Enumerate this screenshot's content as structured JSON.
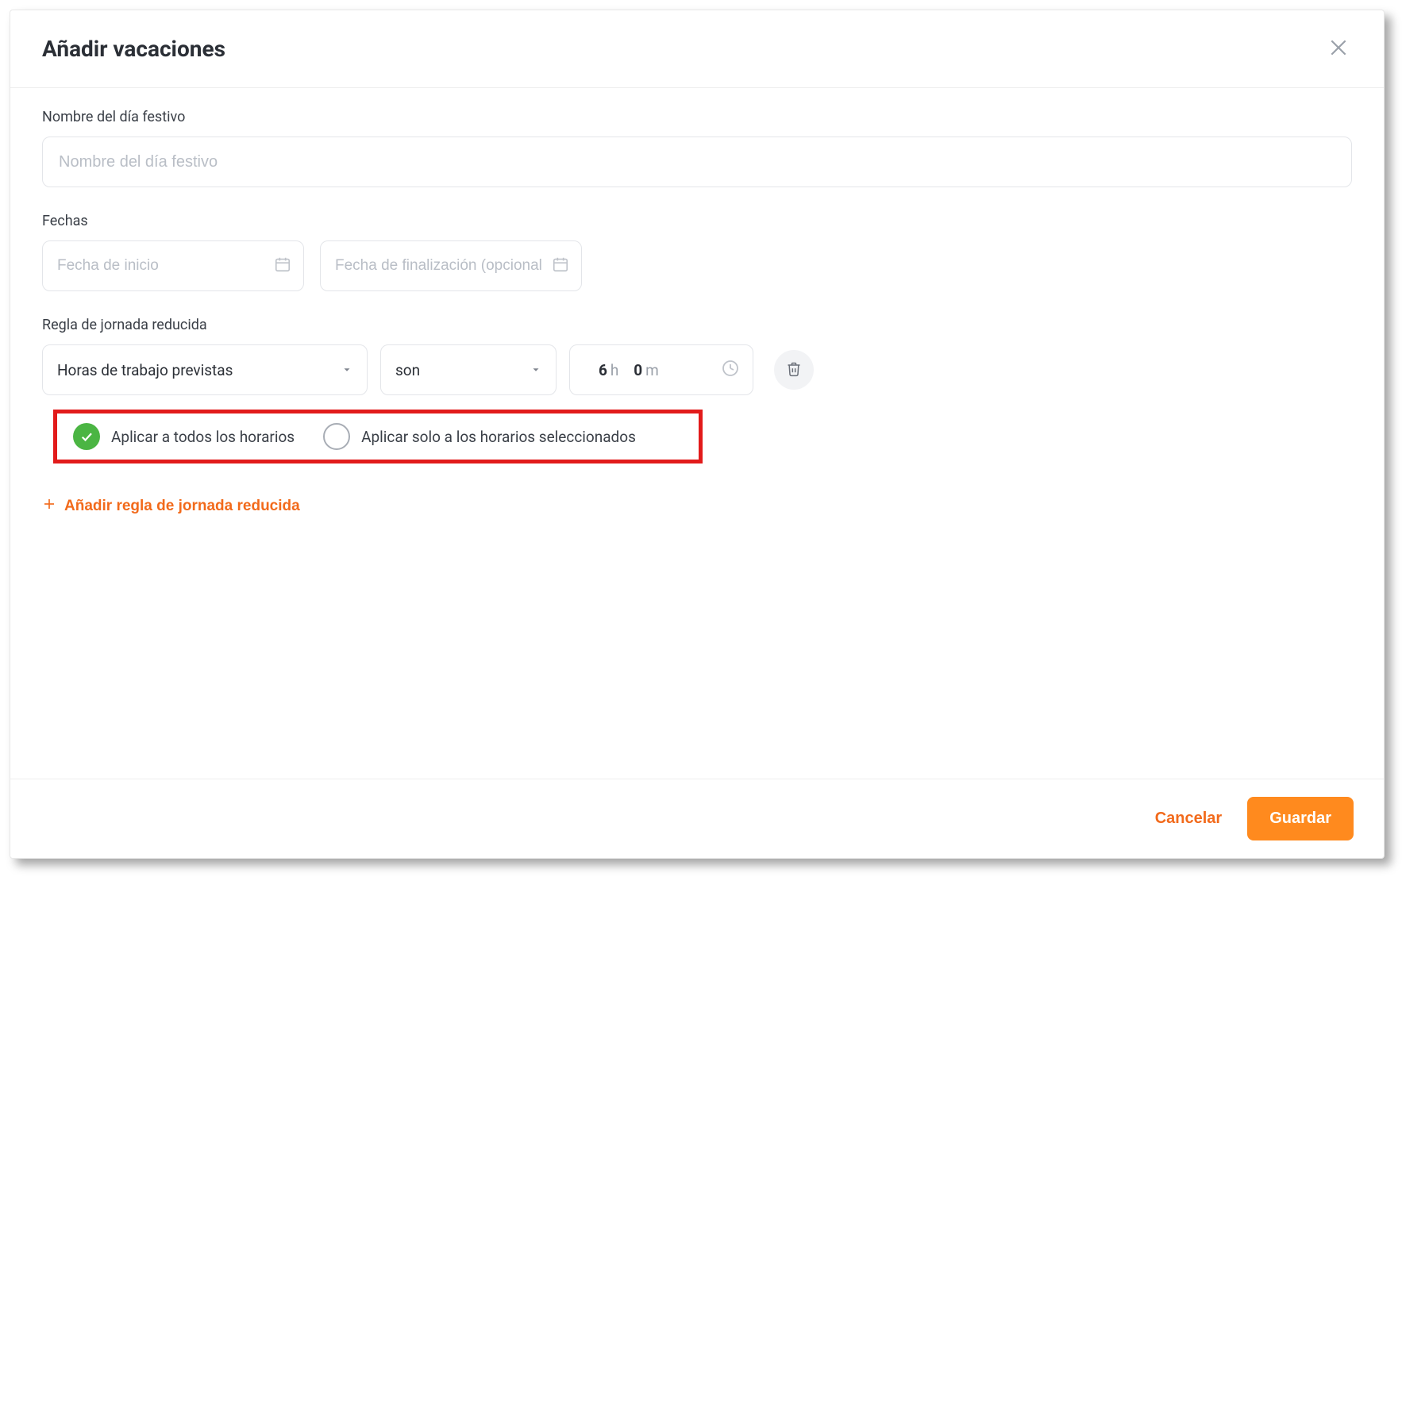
{
  "modal": {
    "title": "Añadir vacaciones"
  },
  "holidayName": {
    "label": "Nombre del día festivo",
    "placeholder": "Nombre del día festivo"
  },
  "dates": {
    "label": "Fechas",
    "startPlaceholder": "Fecha de inicio",
    "endPlaceholder": "Fecha de finalización (opcional)"
  },
  "rule": {
    "label": "Regla de jornada reducida",
    "typeSelected": "Horas de trabajo previstas",
    "operatorSelected": "son",
    "hours": "6",
    "hoursUnit": "h",
    "minutes": "0",
    "minutesUnit": "m"
  },
  "apply": {
    "all": "Aplicar a todos los horarios",
    "selected": "Aplicar solo a los horarios seleccionados"
  },
  "addRule": {
    "label": "Añadir regla de jornada reducida"
  },
  "footer": {
    "cancel": "Cancelar",
    "save": "Guardar"
  }
}
